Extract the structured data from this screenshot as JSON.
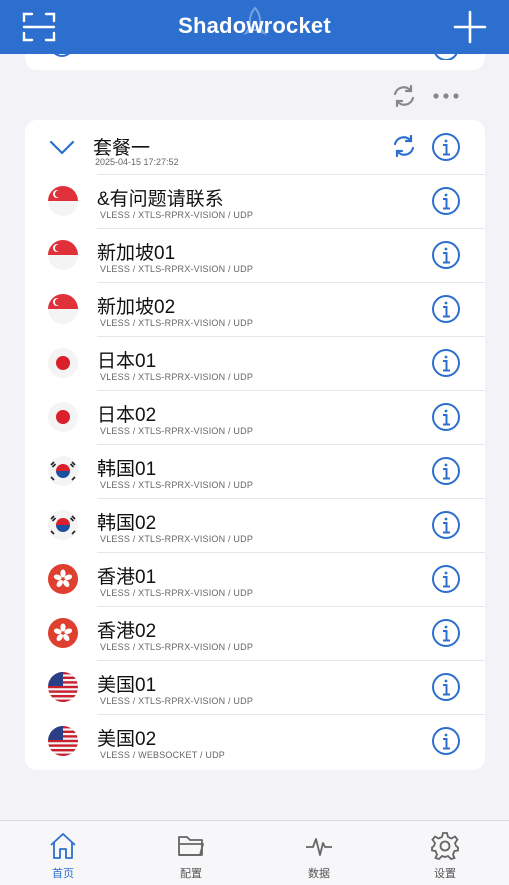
{
  "app": {
    "title": "Shadowrocket",
    "icons": {
      "left": "scan-icon",
      "right": "add-icon"
    }
  },
  "toolbar": {
    "icons": [
      "refresh-icon",
      "more-icon"
    ]
  },
  "group": {
    "name": "套餐一",
    "updated": "2025-04-15 17:27:52",
    "expanded": true
  },
  "servers": [
    {
      "name": "&有问题请联系",
      "protocol": "VLESS / XTLS-RPRX-VISION / UDP",
      "flag": "sg"
    },
    {
      "name": "新加坡01",
      "protocol": "VLESS / XTLS-RPRX-VISION / UDP",
      "flag": "sg"
    },
    {
      "name": "新加坡02",
      "protocol": "VLESS / XTLS-RPRX-VISION / UDP",
      "flag": "sg"
    },
    {
      "name": "日本01",
      "protocol": "VLESS / XTLS-RPRX-VISION / UDP",
      "flag": "jp"
    },
    {
      "name": "日本02",
      "protocol": "VLESS / XTLS-RPRX-VISION / UDP",
      "flag": "jp"
    },
    {
      "name": "韩国01",
      "protocol": "VLESS / XTLS-RPRX-VISION / UDP",
      "flag": "kr"
    },
    {
      "name": "韩国02",
      "protocol": "VLESS / XTLS-RPRX-VISION / UDP",
      "flag": "kr"
    },
    {
      "name": "香港01",
      "protocol": "VLESS / XTLS-RPRX-VISION / UDP",
      "flag": "hk"
    },
    {
      "name": "香港02",
      "protocol": "VLESS / XTLS-RPRX-VISION / UDP",
      "flag": "hk"
    },
    {
      "name": "美国01",
      "protocol": "VLESS / XTLS-RPRX-VISION / UDP",
      "flag": "us"
    },
    {
      "name": "美国02",
      "protocol": "VLESS / WEBSOCKET / UDP",
      "flag": "us"
    }
  ],
  "tabs": [
    {
      "label": "首页",
      "icon": "home-icon",
      "active": true
    },
    {
      "label": "配置",
      "icon": "folder-icon",
      "active": false
    },
    {
      "label": "数据",
      "icon": "pulse-icon",
      "active": false
    },
    {
      "label": "设置",
      "icon": "gear-icon",
      "active": false
    }
  ],
  "colors": {
    "accent": "#2d6fce",
    "background": "#f2f2f7",
    "card": "#ffffff"
  }
}
